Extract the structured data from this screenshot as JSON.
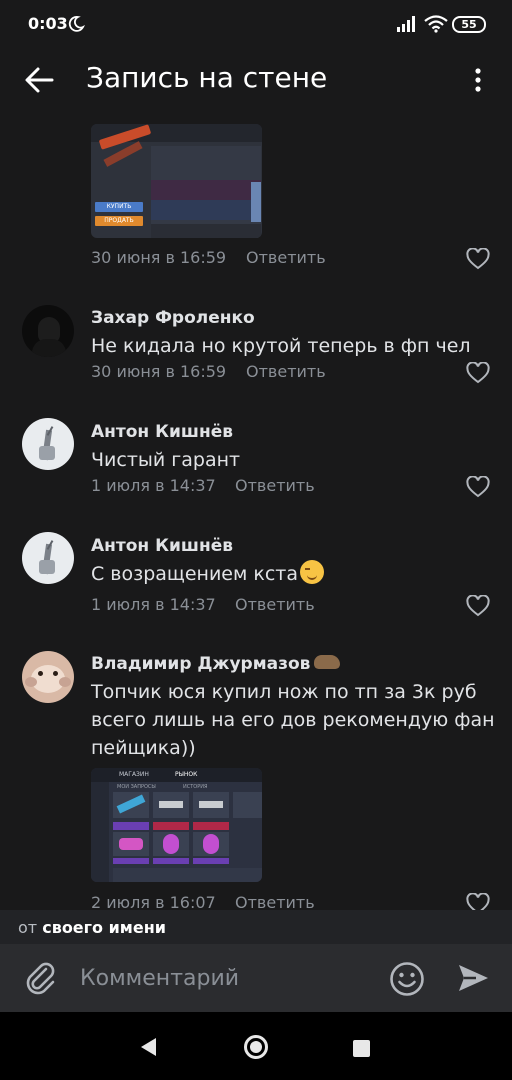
{
  "status_bar": {
    "time": "0:03",
    "battery": "55"
  },
  "header": {
    "title": "Запись на стене"
  },
  "comments": [
    {
      "date": "30 июня в 16:59",
      "reply": "Ответить"
    },
    {
      "author": "Захар Фроленко",
      "text": "Не кидала но крутой теперь в фп чел",
      "date": "30 июня в 16:59",
      "reply": "Ответить"
    },
    {
      "author": "Антон Кишнёв",
      "text": "Чистый гарант",
      "date": "1 июля в 14:37",
      "reply": "Ответить"
    },
    {
      "author": "Антон Кишнёв",
      "text": "С возращением кста",
      "date": "1 июля в 14:37",
      "reply": "Ответить"
    },
    {
      "author": "Владимир Джурмазов",
      "text_lines": [
        "Топчик юся купил нож по тп за 3к руб",
        "всего лишь на его дов рекомендую фан",
        "пейщика))"
      ],
      "date": "2 июля в 16:07",
      "reply": "Ответить"
    }
  ],
  "screenshot_1": {
    "buy_label": "КУПИТЬ",
    "sell_label": "ПРОДАТЬ"
  },
  "screenshot_2": {
    "tab_new": "МОИ ЗАПРОСЫ",
    "tab_history": "ИСТОРИЯ",
    "tab_trade": "РЫНОК",
    "header_left": "МАГАЗИН"
  },
  "sender": {
    "prefix": "от",
    "name": "своего имени"
  },
  "composer": {
    "placeholder": "Комментарий"
  },
  "colors": {
    "background": "#19191a",
    "text": "#e1e3e6",
    "secondary": "#8a8f96",
    "composer": "#2b2c2f"
  }
}
